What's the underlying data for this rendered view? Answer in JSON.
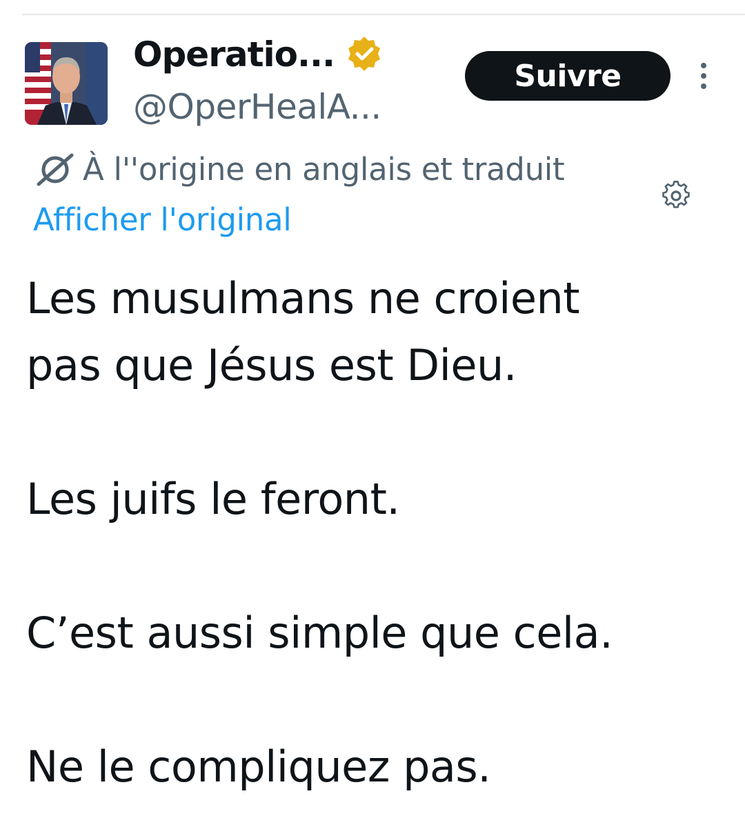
{
  "author": {
    "name": "Operatio...",
    "handle": "@OperHealA...",
    "verified_badge_color": "#e8b118",
    "avatar_icon": "user-photo"
  },
  "follow_button": {
    "label": "Suivre"
  },
  "more_menu": {
    "icon": "vertical-ellipsis-icon"
  },
  "translation": {
    "note": "À l''origine en anglais et traduit",
    "show_original_label": "Afficher l'original",
    "link_color": "#1d9bf0"
  },
  "tweet": {
    "lines": [
      "Les musulmans ne croient",
      "pas que Jésus est Dieu.",
      "",
      "Les juifs le feront.",
      "",
      "C’est aussi simple que cela.",
      "",
      "Ne le compliquez pas."
    ]
  }
}
